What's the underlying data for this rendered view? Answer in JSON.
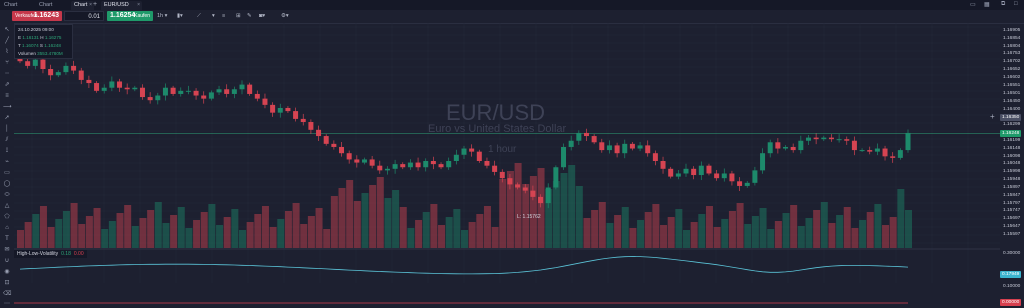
{
  "tabs": [
    {
      "label": "Chart",
      "active": false
    },
    {
      "label": "Chart",
      "active": false
    },
    {
      "label": "Chart",
      "active": false
    },
    {
      "label": "EUR/USD",
      "active": true
    }
  ],
  "trade": {
    "sell_label": "Verkaufen",
    "sell_price": "1.16243",
    "quantity": "0.01",
    "buy_price": "1.16254",
    "buy_label": "Kaufen"
  },
  "toolbar": {
    "timeframe": "1h"
  },
  "info": {
    "date": "24.10.2025 09:00",
    "e_label": "E",
    "e_value": "1.16131",
    "h_label": "H",
    "h_value": "1.16275",
    "t_label": "T",
    "t_value": "1.16074",
    "s_label": "S",
    "s_value": "1.16248",
    "vol_label": "Volumen",
    "vol_value": "3553.4780M"
  },
  "symbol": {
    "name": "EUR/USD",
    "description": "Euro vs United States Dollar",
    "timeframe": "1 hour"
  },
  "low_marker": {
    "text": "L: 1.15762"
  },
  "indicator": {
    "name": "High-Low-Volatility",
    "value_a": "0.18",
    "value_b": "0.00"
  },
  "axis": {
    "ticks": [
      "1.16905",
      "1.16854",
      "1.16804",
      "1.16753",
      "1.16702",
      "1.16652",
      "1.16602",
      "1.16551",
      "1.16501",
      "1.16450",
      "1.16400",
      "1.16350",
      "1.16299",
      "1.16248",
      "1.16199",
      "1.16148",
      "1.16098",
      "1.16048",
      "1.15998",
      "1.15948",
      "1.15897",
      "1.15847",
      "1.15797",
      "1.15747",
      "1.15697",
      "1.15647",
      "1.15597"
    ],
    "crosshair_price": "1.16350",
    "current_price": "1.16248",
    "ind_ticks": [
      "0.30000",
      "0.10000"
    ],
    "ind_current": "0.17949",
    "ind_zero": "0.00000"
  },
  "colors": {
    "up": "#1d8a6b",
    "down": "#d64452",
    "background": "#1d2030",
    "accent": "#2ea77a"
  },
  "chart_data": {
    "type": "candlestick",
    "timeframe": "1 hour",
    "closes": [
      1.1671,
      1.1668,
      1.1672,
      1.1666,
      1.1662,
      1.1664,
      1.1668,
      1.1665,
      1.1659,
      1.1657,
      1.1652,
      1.1654,
      1.1658,
      1.1654,
      1.1653,
      1.1654,
      1.1648,
      1.1646,
      1.1649,
      1.1654,
      1.165,
      1.1652,
      1.1652,
      1.1649,
      1.1647,
      1.1651,
      1.1653,
      1.165,
      1.1653,
      1.1656,
      1.165,
      1.1647,
      1.1643,
      1.1638,
      1.1641,
      1.1639,
      1.1634,
      1.1632,
      1.1627,
      1.1623,
      1.1618,
      1.1616,
      1.1612,
      1.1608,
      1.1606,
      1.1608,
      1.1604,
      1.1601,
      1.1602,
      1.1605,
      1.1603,
      1.1606,
      1.1603,
      1.1607,
      1.1605,
      1.1603,
      1.1607,
      1.1611,
      1.1615,
      1.1613,
      1.1607,
      1.1604,
      1.16,
      1.1596,
      1.1592,
      1.159,
      1.1588,
      1.1584,
      1.158,
      1.159,
      1.1603,
      1.1616,
      1.162,
      1.1625,
      1.1623,
      1.1619,
      1.1614,
      1.1617,
      1.1612,
      1.1618,
      1.1615,
      1.1617,
      1.1612,
      1.1607,
      1.1602,
      1.1597,
      1.1599,
      1.1602,
      1.1598,
      1.1604,
      1.1599,
      1.1596,
      1.1599,
      1.1594,
      1.1591,
      1.1593,
      1.1601,
      1.1612,
      1.1619,
      1.1615,
      1.1616,
      1.1614,
      1.162,
      1.1622,
      1.1621,
      1.1622,
      1.1621,
      1.1621,
      1.162,
      1.1614,
      1.1614,
      1.1613,
      1.1615,
      1.161,
      1.1609,
      1.1614,
      1.1625
    ],
    "high_low_volatility": {
      "current": 0.18,
      "axis_ticks": [
        0.1,
        0.3
      ]
    },
    "low": 1.15762,
    "current": 1.16248
  }
}
